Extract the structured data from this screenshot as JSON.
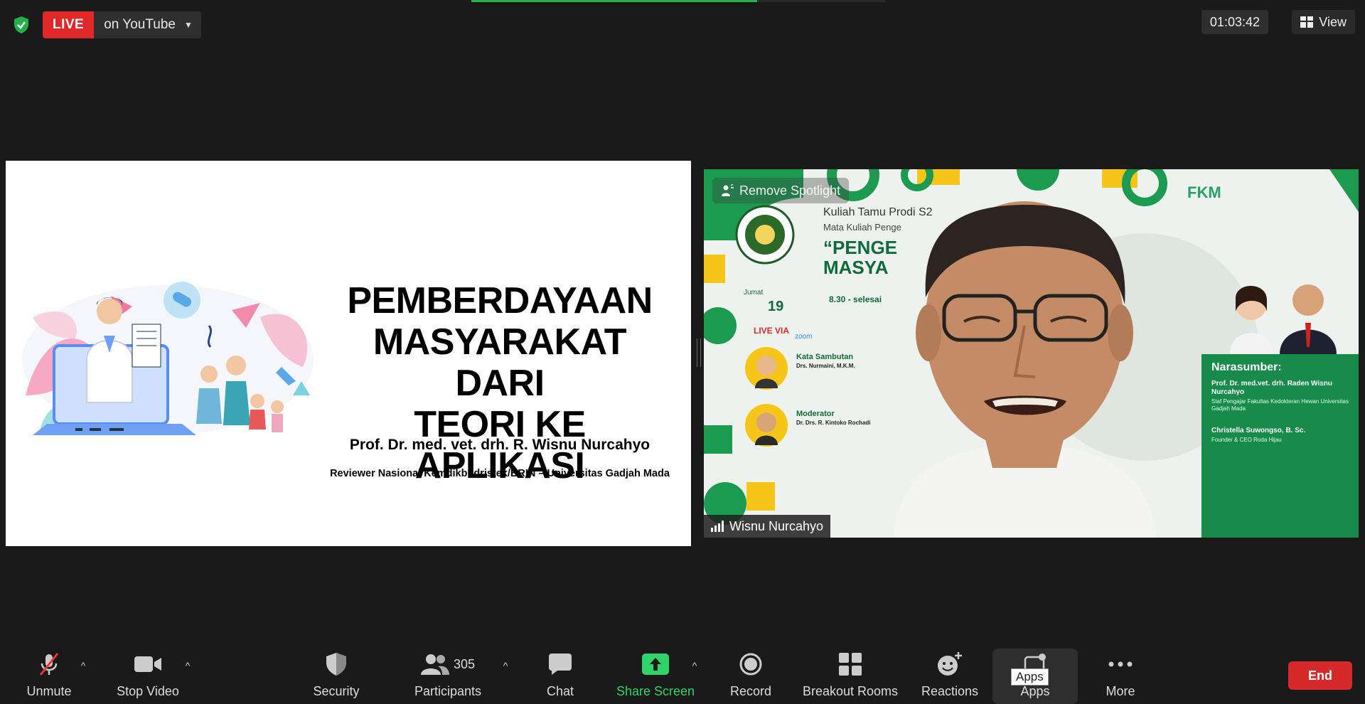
{
  "header": {
    "live_label": "LIVE",
    "stream_target": "on YouTube",
    "timer": "01:03:42",
    "view_label": "View",
    "progress": 0.69
  },
  "slide": {
    "title_lines": [
      "PEMBERDAYAAN",
      "MASYARAKAT DARI",
      "TEORI KE APLIKASI"
    ],
    "author": "Prof. Dr. med. vet. drh. R. Wisnu Nurcahyo",
    "affiliation": "Reviewer Nasional Kemdikbudristek/BRIN – Universitas Gadjah Mada"
  },
  "video": {
    "spotlight_label": "Remove Spotlight",
    "participant_name": "Wisnu Nurcahyo",
    "poster": {
      "title1": "Kuliah Tamu Prodi S2",
      "title2": "Mata Kuliah Penge",
      "big1": "“PENGE",
      "big2": "MASYA",
      "fkm": "FKM",
      "jumat": "Jumat",
      "day": "19",
      "time": "8.30 - selesai",
      "live_via": "LIVE VIA",
      "zoom": "zoom",
      "kata_sambutan": "Kata Sambutan",
      "kata_name": "Drs. Nurmaini, M.K.M.",
      "moderator": "Moderator",
      "moderator_name": "Dr. Drs. R. Kintoko Rochadi",
      "narasumber": "Narasumber:",
      "nara1": "Prof. Dr. med.vet. drh. Raden Wisnu Nurcahyo",
      "nara1_sub": "Staf Pengajar Fakultas Kedokteran Hewan Universitas Gadjah Mada",
      "nara2": "Christella Suwongso, B. Sc.",
      "nara2_sub": "Founder & CEO Roda Hijau"
    }
  },
  "toolbar": {
    "unmute": "Unmute",
    "stop_video": "Stop Video",
    "security": "Security",
    "participants": "Participants",
    "participant_count": "305",
    "chat": "Chat",
    "share_screen": "Share Screen",
    "record": "Record",
    "breakout_rooms": "Breakout Rooms",
    "reactions": "Reactions",
    "apps": "Apps",
    "apps_tooltip": "Apps",
    "more": "More",
    "end": "End"
  },
  "colors": {
    "live_red": "#e02828",
    "share_green": "#2fd36a",
    "end_red": "#d42a2a",
    "background": "#1a1a1a"
  }
}
